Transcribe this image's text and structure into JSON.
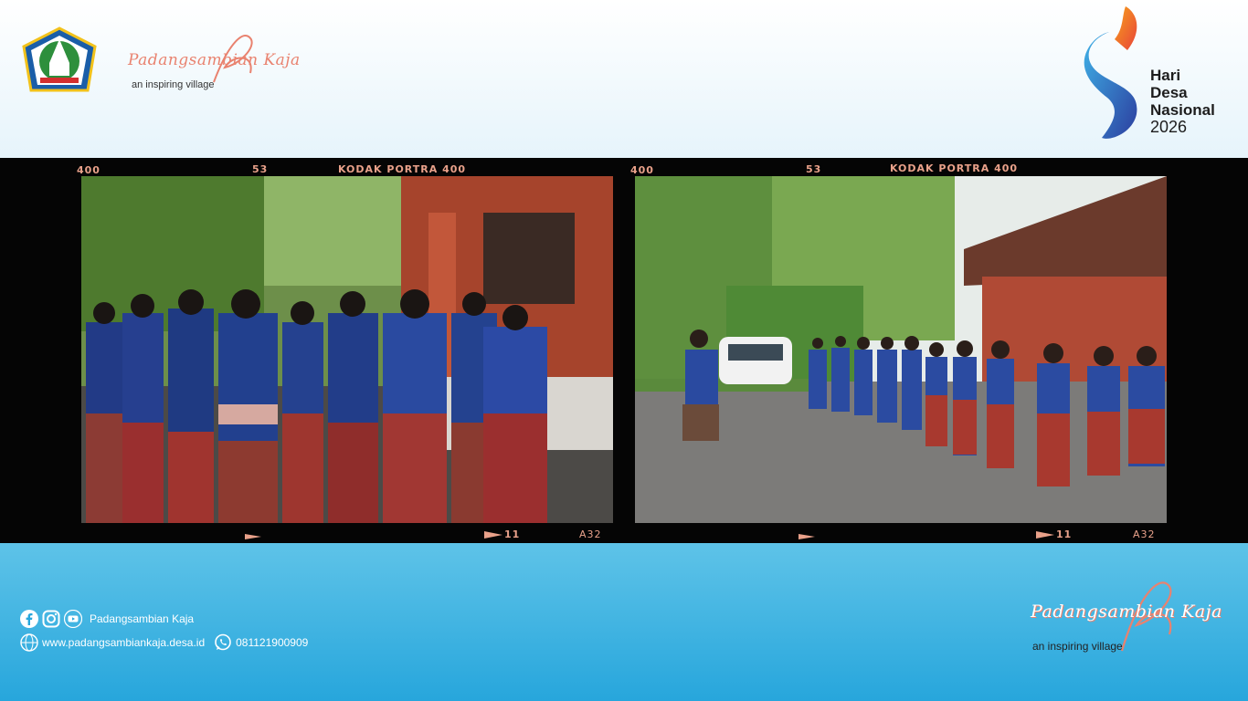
{
  "header": {
    "brand_script": "Padangsambian Kaja",
    "brand_tagline": "an inspiring village",
    "event_line1": "Hari",
    "event_line2": "Desa",
    "event_line3": "Nasional",
    "event_year": "2026"
  },
  "film": {
    "edge_left": "400",
    "edge_frame": "53",
    "edge_brand": "KODAK PORTRA 400",
    "edge_bottom_num": "11",
    "edge_bottom_code": "A32"
  },
  "footer": {
    "social_name": "Padangsambian Kaja",
    "website": "www.padangsambiankaja.desa.id",
    "whatsapp": "081121900909",
    "brand_script": "Padangsambian Kaja",
    "brand_tagline": "an inspiring village"
  },
  "colors": {
    "brand_accent": "#e9826f",
    "footer_blue": "#27a6dc",
    "film_black": "#050505"
  },
  "icons": [
    "facebook-icon",
    "instagram-icon",
    "youtube-icon",
    "globe-icon",
    "whatsapp-icon"
  ]
}
